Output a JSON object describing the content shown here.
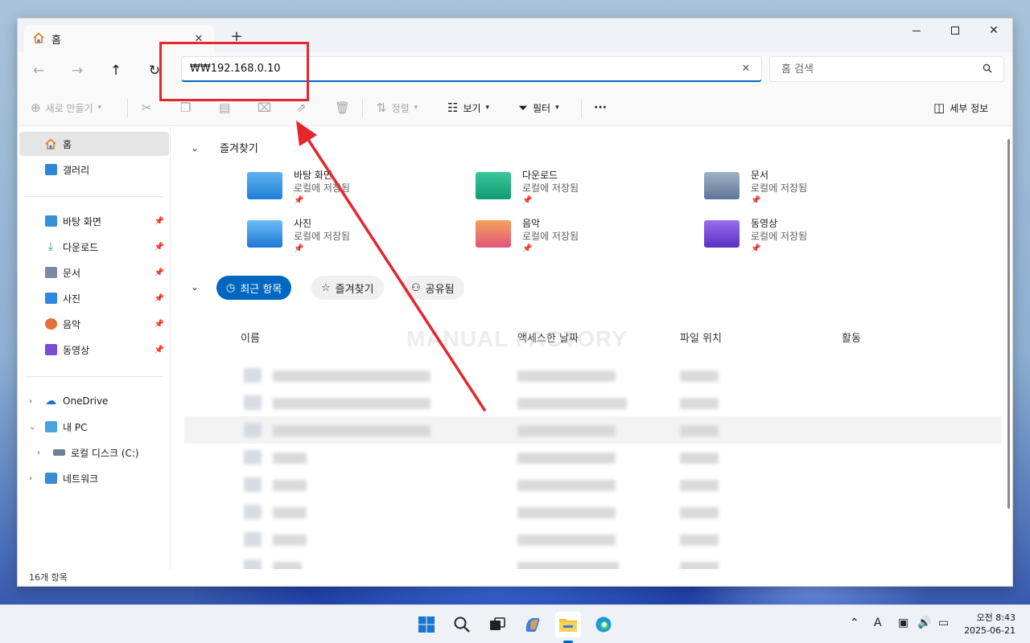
{
  "window": {
    "tab_title": "홈",
    "tab_icon": "home-icon"
  },
  "nav": {
    "address_value": "₩₩192.168.0.10",
    "search_placeholder": "홈 검색"
  },
  "toolbar": {
    "new_label": "새로 만들기",
    "sort_label": "정렬",
    "view_label": "보기",
    "filter_label": "필터",
    "more_label": "···",
    "details_label": "세부 정보"
  },
  "sidebar": {
    "home": "홈",
    "gallery": "갤러리",
    "pinned": [
      {
        "label": "바탕 화면",
        "icon": "desktop-folder-icon",
        "color": "#3a8fd9"
      },
      {
        "label": "다운로드",
        "icon": "download-folder-icon",
        "color": "#1fa37a"
      },
      {
        "label": "문서",
        "icon": "documents-folder-icon",
        "color": "#7a8aa0"
      },
      {
        "label": "사진",
        "icon": "pictures-folder-icon",
        "color": "#2e86de"
      },
      {
        "label": "음악",
        "icon": "music-folder-icon",
        "color": "#e2703a"
      },
      {
        "label": "동영상",
        "icon": "videos-folder-icon",
        "color": "#7b4bd6"
      }
    ],
    "onedrive": "OneDrive",
    "thispc": "내 PC",
    "localdisk": "로컬 디스크 (C:)",
    "network": "네트워크"
  },
  "main": {
    "favorites_title": "즐겨찾기",
    "favorites": [
      {
        "name": "바탕 화면",
        "sub": "로컬에 저장됨",
        "color": "#2f8fe0"
      },
      {
        "name": "다운로드",
        "sub": "로컬에 저장됨",
        "color": "#1aa37d"
      },
      {
        "name": "문서",
        "sub": "로컬에 저장됨",
        "color": "#6f86a8"
      },
      {
        "name": "사진",
        "sub": "로컬에 저장됨",
        "color": "#2c8ae0"
      },
      {
        "name": "음악",
        "sub": "로컬에 저장됨",
        "color": "#e8733e"
      },
      {
        "name": "동영상",
        "sub": "로컬에 저장됨",
        "color": "#7a48d4"
      }
    ],
    "pills": {
      "recent": "최근 항목",
      "favorites": "즐겨찾기",
      "shared": "공유됨"
    },
    "columns": {
      "name": "이름",
      "accessed": "액세스한 날짜",
      "location": "파일 위치",
      "activity": "활동"
    },
    "watermark": "MANUAL FACTORY"
  },
  "status": {
    "count": "16개 항목"
  },
  "taskbar": {
    "time": "오전 8:43",
    "date": "2025-06-21",
    "ime": "A"
  },
  "colors": {
    "accent": "#0067c0",
    "annotation": "#e5262b"
  }
}
